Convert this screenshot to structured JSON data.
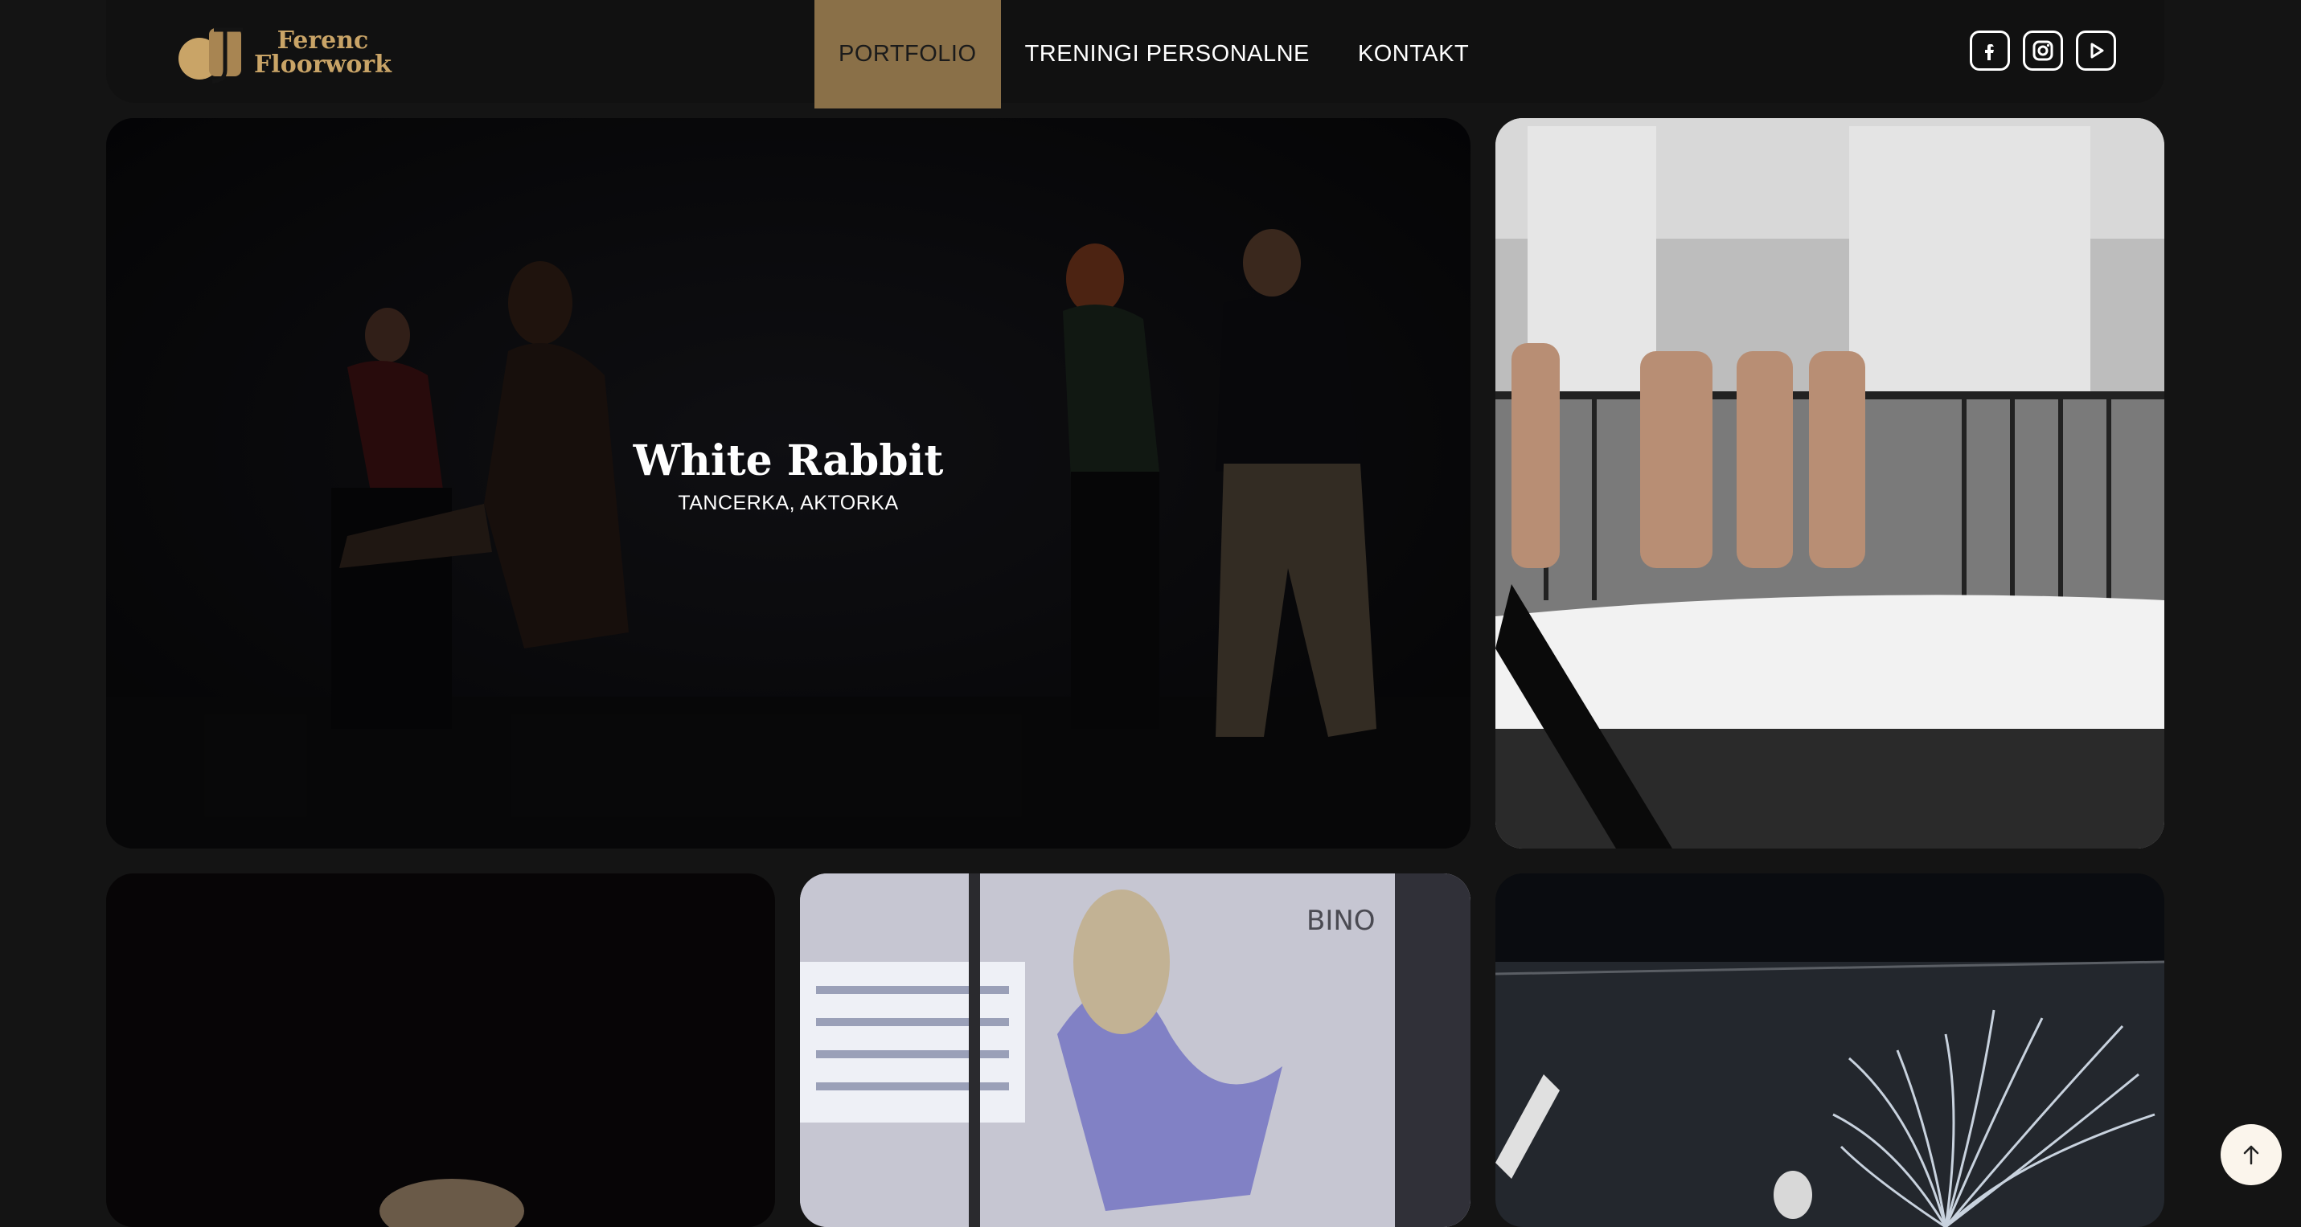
{
  "brand": {
    "name_line1": "Ferenc",
    "name_line2": "Floorwork",
    "accent": "#8a7048",
    "gold": "#c9a467"
  },
  "nav": {
    "items": [
      {
        "label": "PORTFOLIO",
        "active": true
      },
      {
        "label": "TRENINGI PERSONALNE",
        "active": false
      },
      {
        "label": "KONTAKT",
        "active": false
      }
    ]
  },
  "socials": [
    "facebook-icon",
    "instagram-icon",
    "youtube-icon"
  ],
  "gallery": {
    "featured": {
      "title": "White Rabbit",
      "subtitle": "TANCERKA, AKTORKA"
    },
    "photo_signage": "BINO"
  },
  "scroll_top": {
    "icon": "arrow-up-icon"
  }
}
